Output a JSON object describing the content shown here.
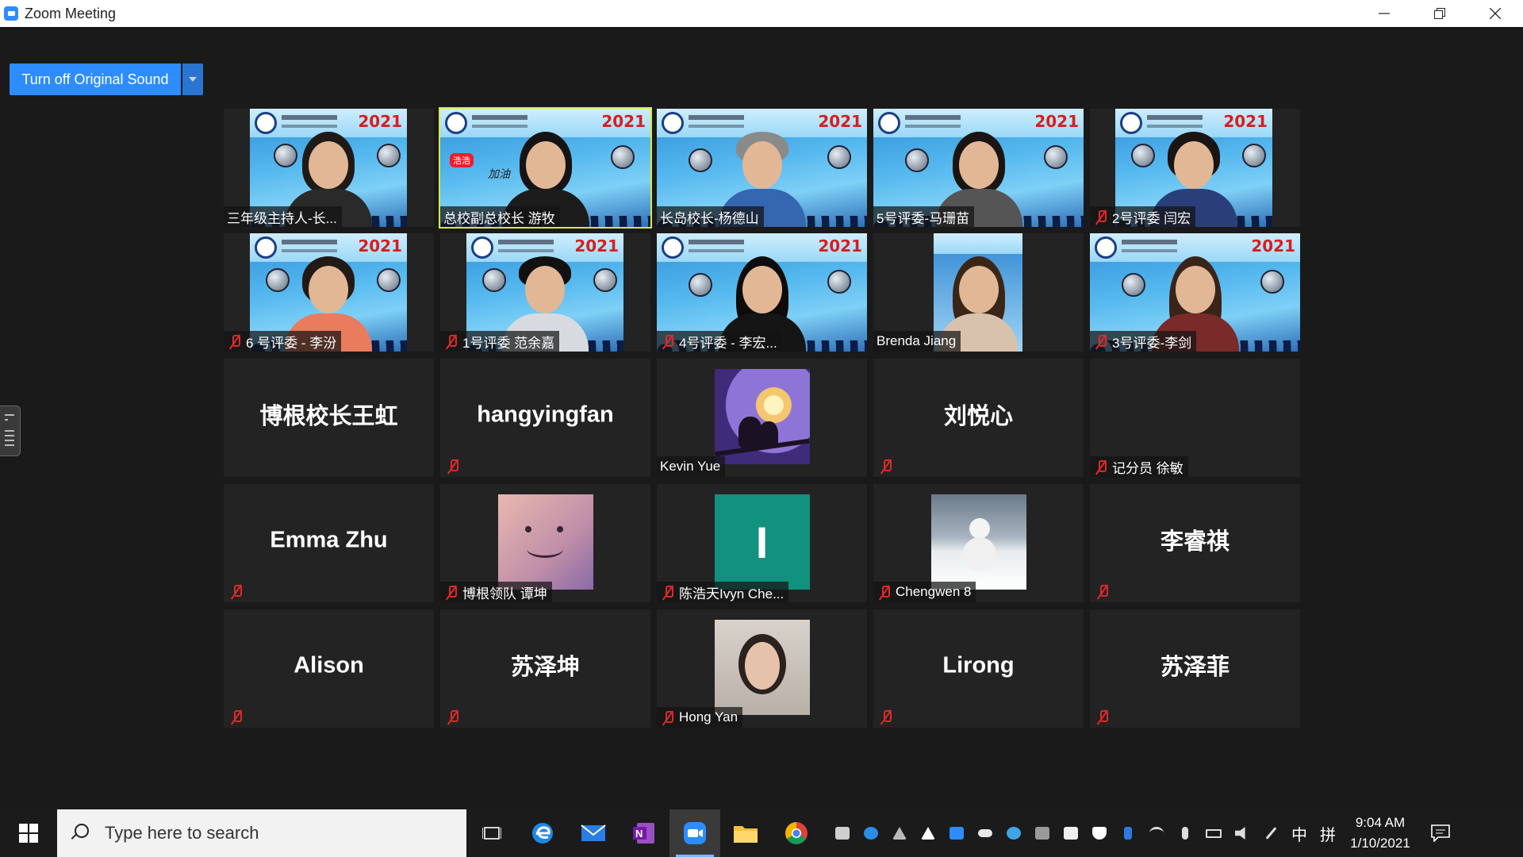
{
  "window": {
    "title": "Zoom Meeting"
  },
  "toolbar": {
    "original_sound_label": "Turn off Original Sound"
  },
  "tiles": {
    "t1": {
      "label": "三年级主持人-长..."
    },
    "t2": {
      "label": "总校副总校长 游牧"
    },
    "t3": {
      "label": "长岛校长-杨德山"
    },
    "t4": {
      "label": "5号评委-马珊苗"
    },
    "t5": {
      "label": "2号评委 闫宏"
    },
    "t6": {
      "label": "6 号评委 - 李汾"
    },
    "t7": {
      "label": "1号评委 范余嘉"
    },
    "t8": {
      "label": "4号评委 - 李宏..."
    },
    "t9": {
      "label": "Brenda Jiang"
    },
    "t10": {
      "label": "3号评委-李剑"
    },
    "t11": {
      "name": "博根校长王虹"
    },
    "t12": {
      "name": "hangyingfan"
    },
    "t13": {
      "label": "Kevin Yue"
    },
    "t14": {
      "name": "刘悦心"
    },
    "t15": {
      "label": "记分员 徐敏"
    },
    "t16": {
      "name": "Emma Zhu"
    },
    "t17": {
      "label": "博根领队 谭坤"
    },
    "t18": {
      "label": "陈浩天Ivyn Che...",
      "avatar_letter": "I"
    },
    "t19": {
      "label": "Chengwen 8"
    },
    "t20": {
      "name": "李睿祺"
    },
    "t21": {
      "name": "Alison"
    },
    "t22": {
      "name": "苏泽坤"
    },
    "t23": {
      "label": "Hong Yan"
    },
    "t24": {
      "name": "Lirong"
    },
    "t25": {
      "name": "苏泽菲"
    }
  },
  "banner": {
    "year": "2021",
    "cheer_tag": "浩浩",
    "cheer_text": "加油"
  },
  "taskbar": {
    "search_placeholder": "Type here to search",
    "ime_lang": "中",
    "ime_mode": "拼",
    "time": "9:04 AM",
    "date": "1/10/2021"
  },
  "colors": {
    "zoom_blue": "#2d8cff",
    "active_speaker": "#d6e84a",
    "mute_red": "#e02828",
    "avatar_teal": "#12917e"
  }
}
